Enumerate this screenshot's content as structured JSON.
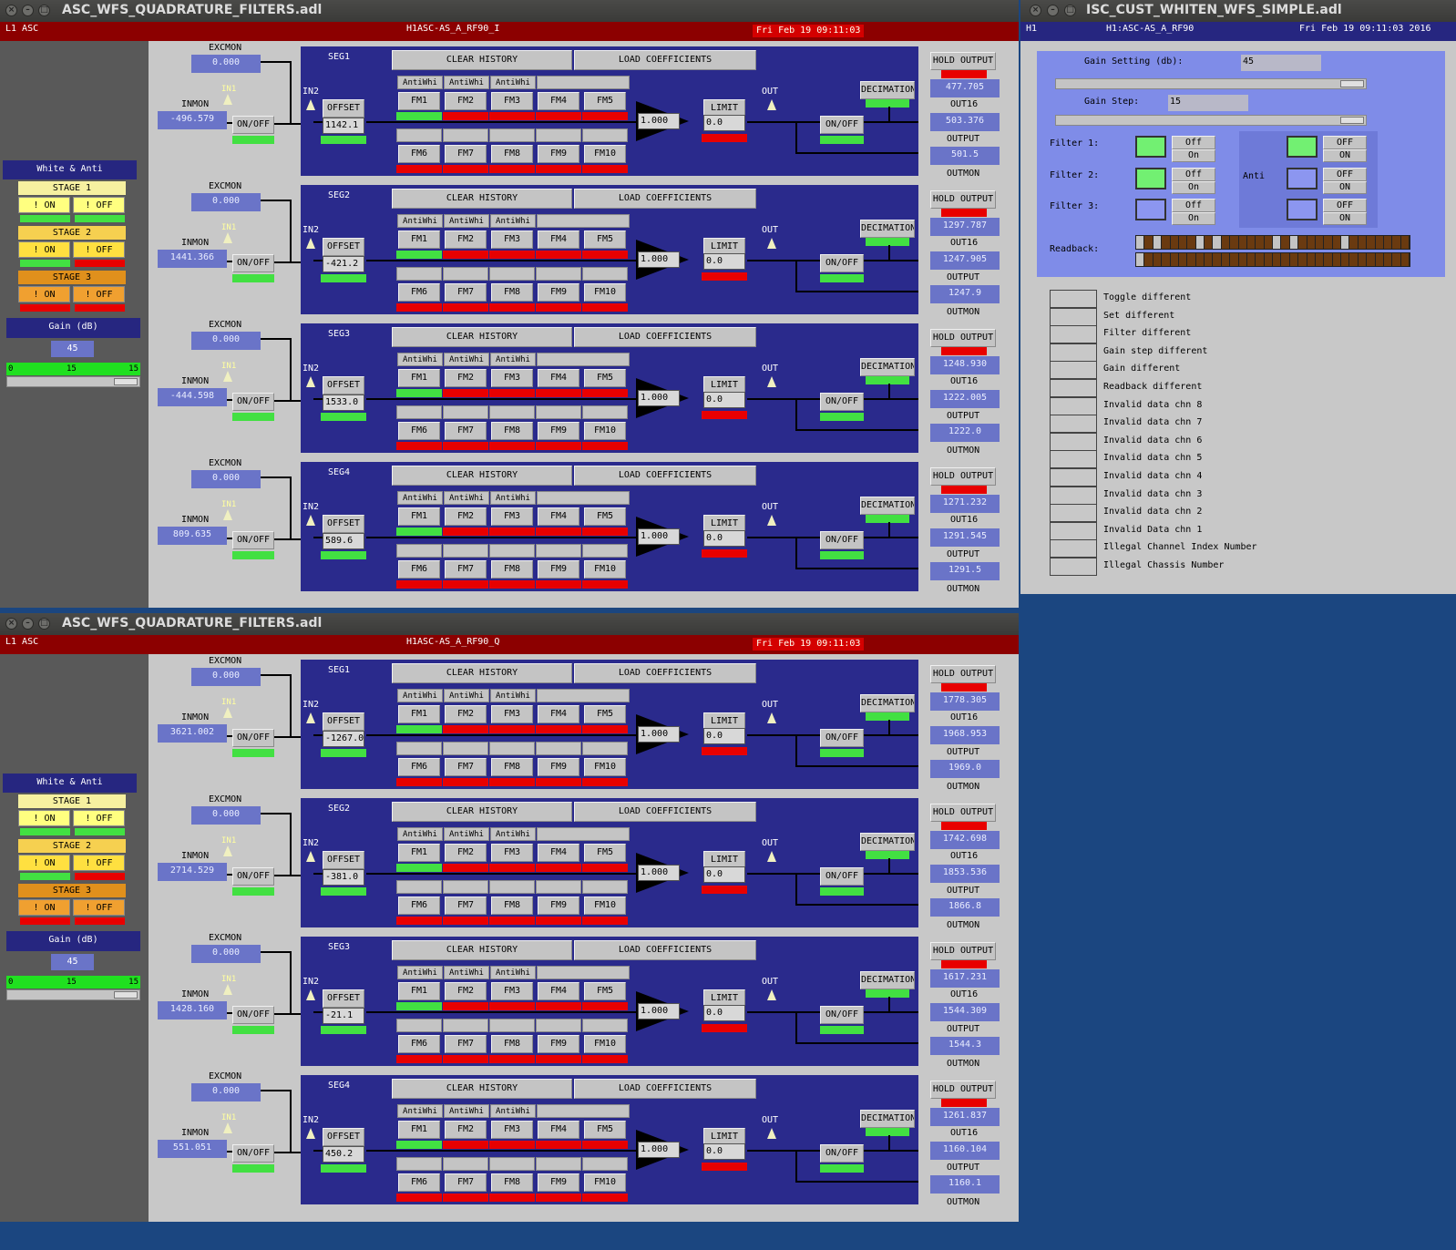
{
  "windows": [
    {
      "title": "ASC_WFS_QUADRATURE_FILTERS.adl",
      "site": "L1 ASC",
      "channel": "H1ASC-AS_A_RF90_I",
      "date": "Fri Feb 19 09:11:03",
      "segs": [
        {
          "name": "SEG1",
          "inmon": "-496.579",
          "offset": "1142.1",
          "hold": "477.705",
          "out16": "503.376",
          "output": "501.5"
        },
        {
          "name": "SEG2",
          "inmon": "1441.366",
          "offset": "-421.2",
          "hold": "1297.787",
          "out16": "1247.905",
          "output": "1247.9"
        },
        {
          "name": "SEG3",
          "inmon": "-444.598",
          "offset": "1533.0",
          "hold": "1248.930",
          "out16": "1222.005",
          "output": "1222.0"
        },
        {
          "name": "SEG4",
          "inmon": "809.635",
          "offset": "589.6",
          "hold": "1271.232",
          "out16": "1291.545",
          "output": "1291.5"
        }
      ]
    },
    {
      "title": "ASC_WFS_QUADRATURE_FILTERS.adl",
      "site": "L1 ASC",
      "channel": "H1ASC-AS_A_RF90_Q",
      "date": "Fri Feb 19 09:11:03",
      "segs": [
        {
          "name": "SEG1",
          "inmon": "3621.002",
          "offset": "-1267.0",
          "hold": "1778.305",
          "out16": "1968.953",
          "output": "1969.0"
        },
        {
          "name": "SEG2",
          "inmon": "2714.529",
          "offset": "-381.0",
          "hold": "1742.698",
          "out16": "1853.536",
          "output": "1866.8"
        },
        {
          "name": "SEG3",
          "inmon": "1428.160",
          "offset": "-21.1",
          "hold": "1617.231",
          "out16": "1544.309",
          "output": "1544.3"
        },
        {
          "name": "SEG4",
          "inmon": "551.051",
          "offset": "450.2",
          "hold": "1261.837",
          "out16": "1160.104",
          "output": "1160.1"
        }
      ]
    }
  ],
  "seg_common": {
    "excmon_label": "EXCMON",
    "excmon_value": "0.000",
    "inmon_label": "INMON",
    "in1": "IN1",
    "in2": "IN2",
    "onoff": "ON/OFF",
    "offset": "OFFSET",
    "clear": "CLEAR HISTORY",
    "load": "LOAD COEFFICIENTS",
    "antiwhi": "AntiWhi",
    "fm_top": [
      "FM1",
      "FM2",
      "FM3",
      "FM4",
      "FM5"
    ],
    "fm_bot": [
      "FM6",
      "FM7",
      "FM8",
      "FM9",
      "FM10"
    ],
    "gain": "1.000",
    "limit": "LIMIT",
    "limit_val": "0.0",
    "out": "OUT",
    "decimation": "DECIMATION",
    "hold": "HOLD OUTPUT",
    "out16": "OUT16",
    "output": "OUTPUT",
    "outmon": "OUTMON"
  },
  "left_common": {
    "white_anti": "White &  Anti",
    "stage1": "STAGE 1",
    "stage2": "STAGE 2",
    "stage3": "STAGE 3",
    "on": "! ON",
    "off": "! OFF",
    "gain_db": "Gain (dB)",
    "gain": "45",
    "slider_min": "0",
    "slider_mid": "15",
    "slider_max": "15"
  },
  "whiten": {
    "title": "ISC_CUST_WHITEN_WFS_SIMPLE.adl",
    "site": "H1",
    "channel": "H1:ASC-AS_A_RF90",
    "date": "Fri Feb 19 09:11:03 2016",
    "gain_setting_label": "Gain Setting (db):",
    "gain_setting": "45",
    "gain_step_label": "Gain Step:",
    "gain_step": "15",
    "filter1": "Filter 1:",
    "filter2": "Filter 2:",
    "filter3": "Filter 3:",
    "off_label": "Off",
    "on_label": "On",
    "anti_off": "OFF",
    "anti_on": "ON",
    "anti": "Anti",
    "readback": "Readback:",
    "status": [
      "Toggle different",
      "Set different",
      "Filter different",
      "Gain step different",
      "Gain different",
      "Readback different",
      "Invalid data chn 8",
      "Invalid data chn 7",
      "Invalid data chn 6",
      "Invalid data chn 5",
      "Invalid data chn 4",
      "Invalid data chn 3",
      "Invalid data chn 2",
      "Invalid Data chn 1",
      "Illegal Channel Index Number",
      "Illegal Chassis Number"
    ]
  },
  "colors": {
    "panel_blue": "#2a2a8c",
    "value_blue": "#6a74c8",
    "green": "#42e042",
    "red": "#e80000",
    "title_red": "#8c0000"
  }
}
